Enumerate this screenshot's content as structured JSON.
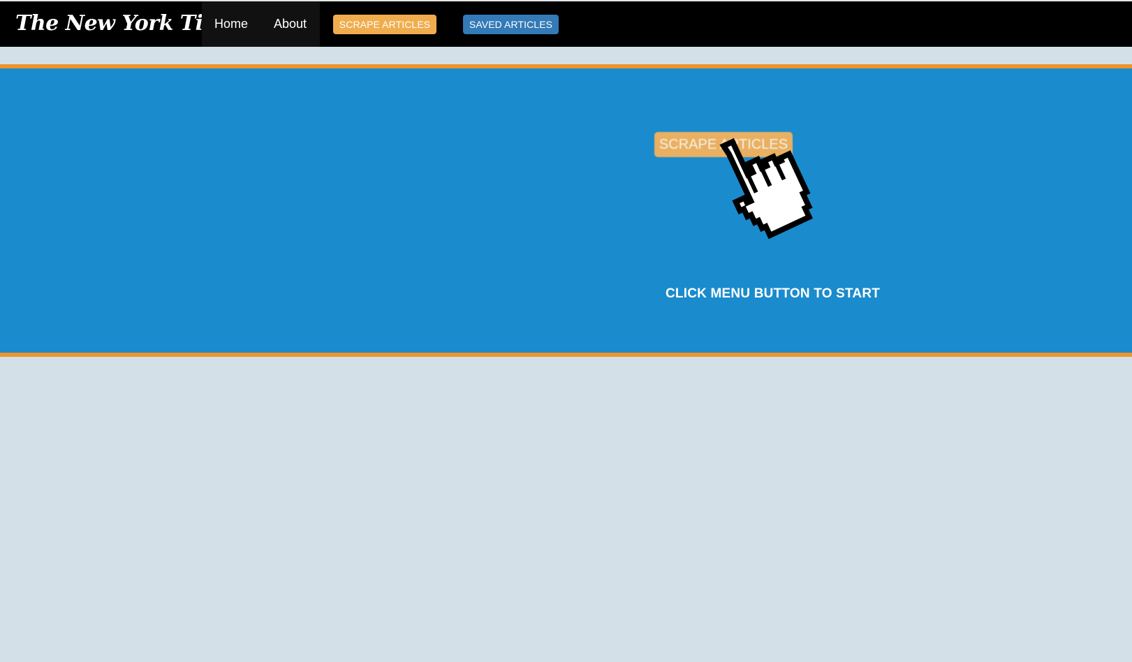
{
  "navbar": {
    "brand": "The New York Times",
    "links": [
      {
        "label": "Home"
      },
      {
        "label": "About"
      }
    ],
    "scrape_button": "SCRAPE ARTICLES",
    "saved_button": "SAVED ARTICLES"
  },
  "hero": {
    "demo_button_label": "SCRAPE ARTICLES",
    "cursor_icon": "pointer-hand-icon",
    "instruction": "CLICK MENU BUTTON TO START"
  },
  "colors": {
    "navbar": "#000000",
    "accent_orange": "#f0ad4e",
    "accent_blue": "#337ab7",
    "hero_blue": "#1a8bcc",
    "hero_border": "#f0932b",
    "page_bg": "#d4e0e8"
  }
}
